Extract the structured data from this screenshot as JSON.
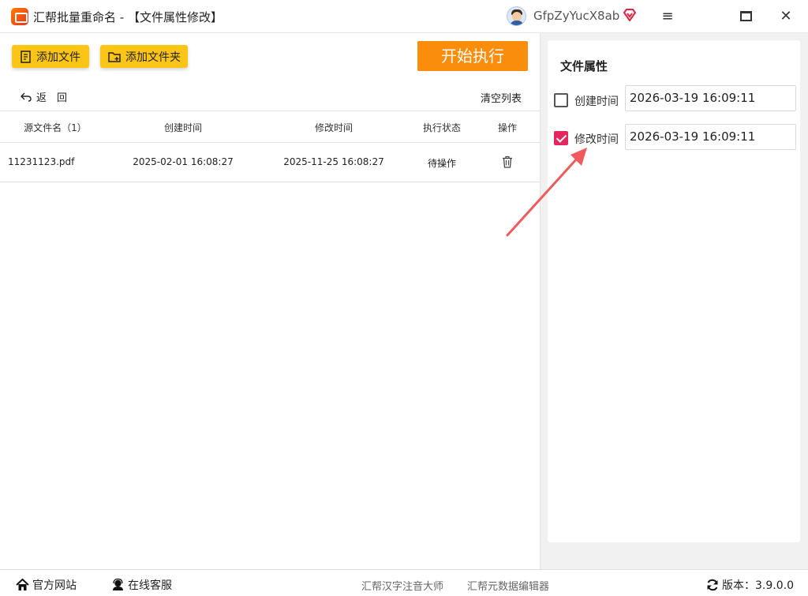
{
  "window": {
    "title": "汇帮批量重命名 - 【文件属性修改】",
    "username": "GfpZyYucX8ab",
    "menu_glyph": "≡",
    "close_glyph": "✕"
  },
  "toolbar": {
    "add_file_label": "添加文件",
    "add_folder_label": "添加文件夹",
    "start_label": "开始执行",
    "back_label": "返　回",
    "clear_label": "清空列表"
  },
  "table": {
    "headers": [
      "源文件名（1）",
      "创建时间",
      "修改时间",
      "执行状态",
      "操作"
    ],
    "rows": [
      {
        "name": "11231123.pdf",
        "created": "2025-02-01 16:08:27",
        "modified": "2025-11-25 16:08:27",
        "status": "待操作"
      }
    ]
  },
  "properties": {
    "title": "文件属性",
    "items": [
      {
        "label": "创建时间",
        "checked": false,
        "value": "2026-03-19 16:09:11"
      },
      {
        "label": "修改时间",
        "checked": true,
        "value": "2026-03-19 16:09:11"
      }
    ]
  },
  "footer": {
    "website_label": "官方网站",
    "support_label": "在线客服",
    "link1": "汇帮汉字注音大师",
    "link2": "汇帮元数据编辑器",
    "version_label": "版本：3.9.0.0"
  },
  "colors": {
    "accent_yellow": "#fac514",
    "start_orange": "#fb8d0c",
    "checkbox_pink": "#e6255f",
    "arrow_red": "#f05a5a"
  }
}
